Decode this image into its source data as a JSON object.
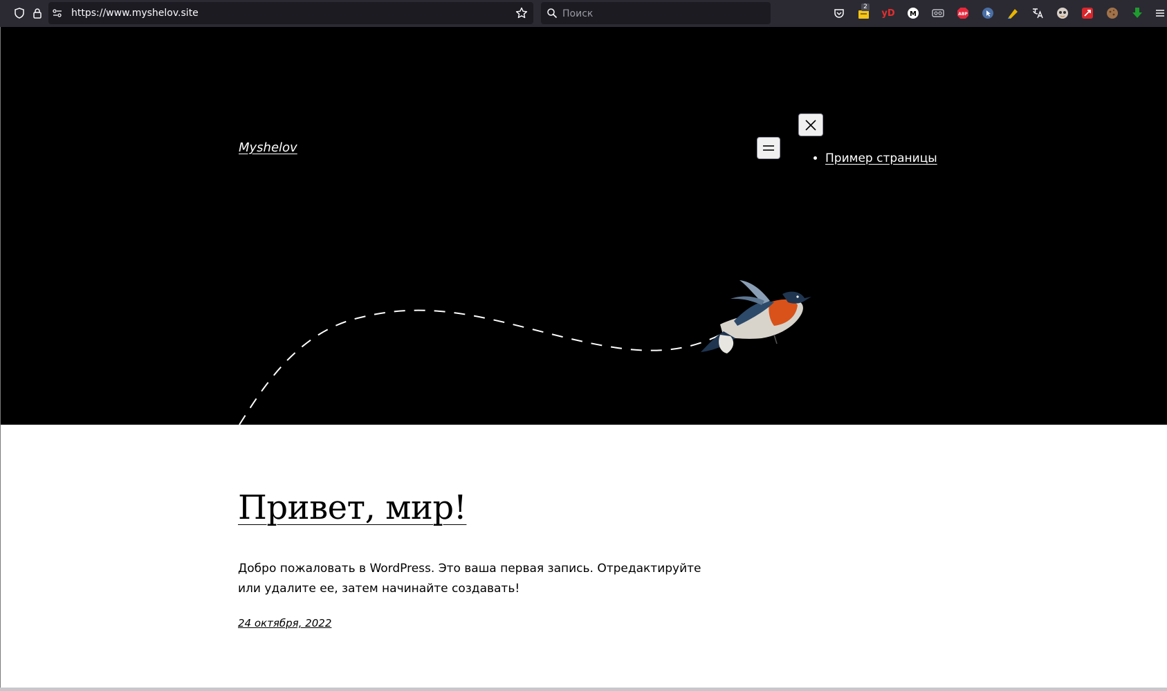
{
  "browser": {
    "url": "https://www.myshelov.site",
    "search_placeholder": "Поиск",
    "extensions": [
      {
        "name": "pocket-icon"
      },
      {
        "name": "extension-badge",
        "badge": "2"
      },
      {
        "name": "yandex-icon",
        "label": "yD"
      },
      {
        "name": "m-extension-icon",
        "label": "M"
      },
      {
        "name": "reader-icon"
      },
      {
        "name": "adblock-icon",
        "label": "ABP"
      },
      {
        "name": "cursor-extension-icon"
      },
      {
        "name": "highlighter-icon"
      },
      {
        "name": "translate-icon"
      },
      {
        "name": "face-extension-icon"
      },
      {
        "name": "red-extension-icon"
      },
      {
        "name": "cookie-icon"
      },
      {
        "name": "download-green-icon"
      },
      {
        "name": "menu-icon"
      }
    ]
  },
  "site": {
    "title": "Myshelov",
    "nav_items": [
      "Пример страницы"
    ]
  },
  "post": {
    "title": "Привет, мир!",
    "excerpt": "Добро пожаловать в WordPress. Это ваша первая запись. Отредактируйте или удалите ее, затем начинайте создавать!",
    "date": "24 октября, 2022"
  },
  "colors": {
    "hero_bg": "#000000",
    "content_bg": "#ffffff",
    "toolbar_bg": "#2b2a33"
  }
}
